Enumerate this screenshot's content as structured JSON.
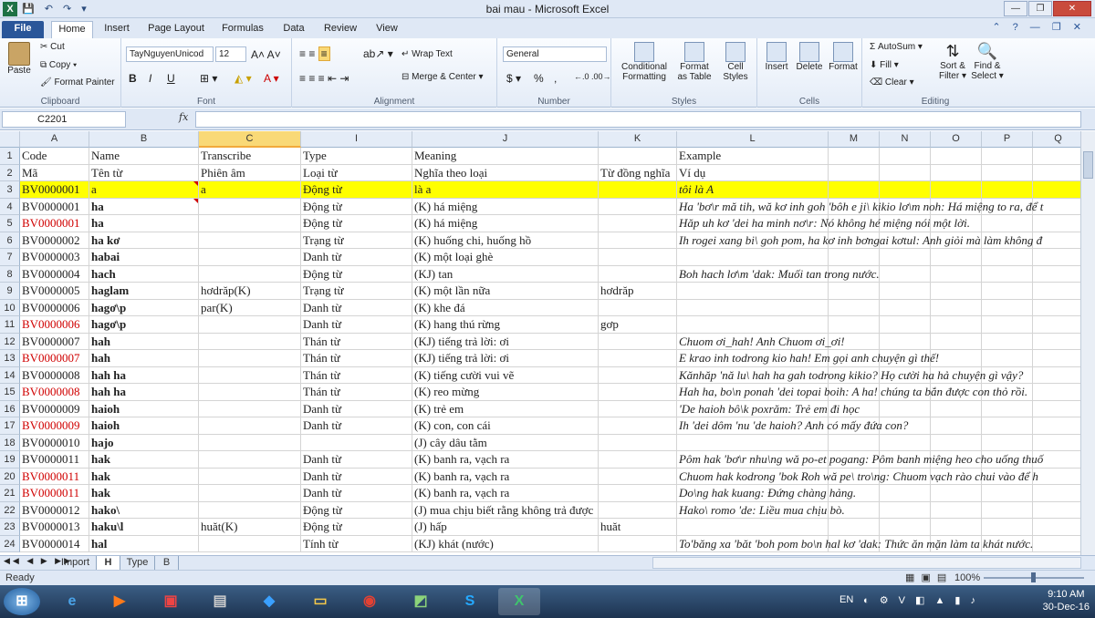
{
  "window": {
    "title": "bai mau - Microsoft Excel",
    "app_icon": "X"
  },
  "tabs": [
    "File",
    "Home",
    "Insert",
    "Page Layout",
    "Formulas",
    "Data",
    "Review",
    "View"
  ],
  "ribbon": {
    "clipboard": {
      "paste": "Paste",
      "cut": "Cut",
      "copy": "Copy",
      "format_painter": "Format Painter",
      "label": "Clipboard"
    },
    "font": {
      "name": "TayNguyenUnicod",
      "size": "12",
      "bold": "B",
      "italic": "I",
      "underline": "U",
      "label": "Font"
    },
    "alignment": {
      "wrap": "Wrap Text",
      "merge": "Merge & Center",
      "label": "Alignment"
    },
    "number": {
      "format": "General",
      "currency": "$",
      "percent": "%",
      "comma": ",",
      "label": "Number"
    },
    "styles": {
      "conditional": "Conditional",
      "formatting": "Formatting",
      "format_as": "Format",
      "as_table": "as Table",
      "cell": "Cell",
      "styles_btn": "Styles",
      "label": "Styles"
    },
    "cells": {
      "insert": "Insert",
      "delete": "Delete",
      "format": "Format",
      "label": "Cells"
    },
    "editing": {
      "autosum": "AutoSum",
      "fill": "Fill",
      "clear": "Clear",
      "sort": "Sort &",
      "filter": "Filter",
      "find": "Find &",
      "select": "Select",
      "label": "Editing"
    }
  },
  "formula_bar": {
    "name_box": "C2201",
    "fx": "fx",
    "value": ""
  },
  "columns": [
    "A",
    "B",
    "C",
    "I",
    "J",
    "K",
    "L",
    "M",
    "N",
    "O",
    "P",
    "Q"
  ],
  "rows": [
    {
      "n": "1",
      "A": "Code",
      "B": "Name",
      "C": "Transcribe",
      "I": "Type",
      "J": "Meaning",
      "K": "",
      "L": "Example"
    },
    {
      "n": "2",
      "A": "Mã",
      "B": "Tên từ",
      "C": "Phiên âm",
      "I": "Loại từ",
      "J": "Nghĩa theo loại",
      "K": "Từ đồng nghĩa",
      "L": "Ví dụ"
    },
    {
      "n": "3",
      "A": "BV0000001",
      "B": "a",
      "C": "a",
      "I": "Động từ",
      "J": "là a",
      "K": "",
      "L": "tôi là A",
      "hl": true
    },
    {
      "n": "4",
      "A": "BV0000001",
      "B": "ha",
      "C": "",
      "I": "Động từ",
      "J": "(K) há miệng",
      "K": "",
      "L": "Ha 'bơ\\r mă tih, wă kơ inh goh 'bôh e ji\\ kikio lơ\\m noh: Há miệng to ra, để t",
      "bold": true
    },
    {
      "n": "5",
      "A": "BV0000001",
      "B": "ha",
      "C": "",
      "I": "Động từ",
      "J": "(K) há miệng",
      "K": "",
      "L": "Hăp uh kơ 'dei ha minh nơ\\r: Nó không hé miệng nói một lời.",
      "red": true,
      "bold": true
    },
    {
      "n": "6",
      "A": "BV0000002",
      "B": "ha kơ",
      "C": "",
      "I": "Trạng từ",
      "J": "(K) huống chi, huống hồ",
      "K": "",
      "L": "Ih rogei xang bi\\ goh pom, ha kơ inh bơngai kơtul: Anh giỏi mà làm không đ",
      "bold": true
    },
    {
      "n": "7",
      "A": "BV0000003",
      "B": "habai",
      "C": "",
      "I": "Danh từ",
      "J": "(K) một loại ghè",
      "K": "",
      "L": "",
      "bold": true
    },
    {
      "n": "8",
      "A": "BV0000004",
      "B": "hach",
      "C": "",
      "I": "Động từ",
      "J": "(KJ) tan",
      "K": "",
      "L": "Boh hach lơ\\m 'dak: Muối tan trong nước.",
      "bold": true
    },
    {
      "n": "9",
      "A": "BV0000005",
      "B": "haglam",
      "C": "hơdrăp(K)",
      "I": "Trạng từ",
      "J": "(K) một lần nữa",
      "K": "hơdrăp",
      "L": "",
      "bold": true
    },
    {
      "n": "10",
      "A": "BV0000006",
      "B": "hagơ\\p",
      "C": "par(K)",
      "I": "Danh từ",
      "J": "(K) khe đá",
      "K": "",
      "L": "",
      "bold": true
    },
    {
      "n": "11",
      "A": "BV0000006",
      "B": "hagơ\\p",
      "C": "",
      "I": "Danh từ",
      "J": "(K) hang thú rừng",
      "K": "gơp",
      "L": "",
      "red": true,
      "bold": true
    },
    {
      "n": "12",
      "A": "BV0000007",
      "B": "hah",
      "C": "",
      "I": "Thán từ",
      "J": "(KJ) tiếng trả lời: ơi",
      "K": "",
      "L": "Chuom ơi_hah! Anh Chuom ơi_ơi!",
      "bold": true
    },
    {
      "n": "13",
      "A": "BV0000007",
      "B": "hah",
      "C": "",
      "I": "Thán từ",
      "J": "(KJ) tiếng trả lời: ơi",
      "K": "",
      "L": "E krao inh todrong kio hah! Em gọi anh chuyện gì thế!",
      "red": true,
      "bold": true
    },
    {
      "n": "14",
      "A": "BV0000008",
      "B": "hah ha",
      "C": "",
      "I": "Thán từ",
      "J": "(K) tiếng cười vui vẽ",
      "K": "",
      "L": "Kănhăp 'nă lu\\ hah ha gah todrong kikio? Họ cười ha hả chuyện gì vậy?",
      "bold": true
    },
    {
      "n": "15",
      "A": "BV0000008",
      "B": "hah ha",
      "C": "",
      "I": "Thán từ",
      "J": "(K) reo mừng",
      "K": "",
      "L": "Hah ha, bo\\n ponah 'dei topai boih: A  ha! chúng ta bắn được con thỏ rồi.",
      "red": true,
      "bold": true
    },
    {
      "n": "16",
      "A": "BV0000009",
      "B": "haioh",
      "C": "",
      "I": "Danh từ",
      "J": "(K) trẻ em",
      "K": "",
      "L": "'De haioh bô\\k poxrăm: Trẻ em đi học",
      "bold": true
    },
    {
      "n": "17",
      "A": "BV0000009",
      "B": "haioh",
      "C": "",
      "I": "Danh từ",
      "J": "(K) con, con cái",
      "K": "",
      "L": "Ih 'dei dôm 'nu 'de haioh? Anh có mấy đứa con?",
      "red": true,
      "bold": true
    },
    {
      "n": "18",
      "A": "BV0000010",
      "B": "hajo",
      "C": "",
      "I": "",
      "J": "(J) cây dâu tằm",
      "K": "",
      "L": "",
      "bold": true
    },
    {
      "n": "19",
      "A": "BV0000011",
      "B": "hak",
      "C": "",
      "I": "Danh từ",
      "J": "(K) banh ra, vạch ra",
      "K": "",
      "L": "Pôm hak 'bơ\\r nhu\\ng wă po-et pogang: Pôm banh miệng heo cho uống thuố",
      "bold": true
    },
    {
      "n": "20",
      "A": "BV0000011",
      "B": "hak",
      "C": "",
      "I": "Danh từ",
      "J": "(K) banh ra, vạch ra",
      "K": "",
      "L": "Chuom hak kodrong 'bok Roh wă pe\\ tro\\ng: Chuom vạch rào chui vào để h",
      "red": true,
      "bold": true
    },
    {
      "n": "21",
      "A": "BV0000011",
      "B": "hak",
      "C": "",
      "I": "Danh từ",
      "J": "(K) banh ra, vạch ra",
      "K": "",
      "L": "Do\\ng hak kuang: Đứng chàng hảng.",
      "red": true,
      "bold": true
    },
    {
      "n": "22",
      "A": "BV0000012",
      "B": "hako\\",
      "C": "",
      "I": "Động từ",
      "J": "(J) mua chịu biết rằng không trả được",
      "K": "",
      "L": "Hako\\ romo 'de: Liều mua chịu bò.",
      "bold": true
    },
    {
      "n": "23",
      "A": "BV0000013",
      "B": "haku\\l",
      "C": "huăt(K)",
      "I": "Động từ",
      "J": "(J) hấp",
      "K": "huăt",
      "L": "",
      "bold": true
    },
    {
      "n": "24",
      "A": "BV0000014",
      "B": "hal",
      "C": "",
      "I": "Tính từ",
      "J": "(KJ) khát (nước)",
      "K": "",
      "L": "To'băng xa 'băt 'boh pom bo\\n hal kơ 'dak: Thức ăn mặn làm ta khát nước.",
      "bold": true
    }
  ],
  "sheets": [
    "Import",
    "H",
    "Type",
    "B"
  ],
  "active_sheet": "H",
  "status": {
    "ready": "Ready",
    "zoom": "100%"
  },
  "taskbar": {
    "lang": "EN",
    "time": "9:10 AM",
    "date": "30-Dec-16"
  },
  "colors": {
    "accent": "#2a5699",
    "highlight": "#ffff00",
    "red_text": "#d00000",
    "excel_green": "#1e7145"
  }
}
